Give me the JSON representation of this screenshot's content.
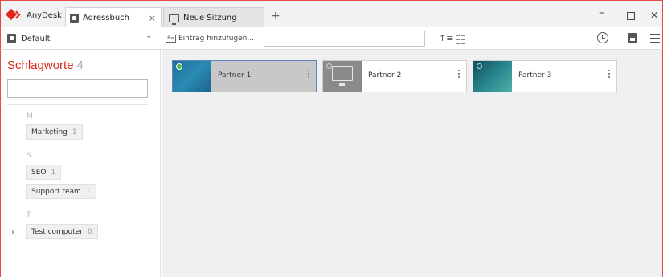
{
  "app": {
    "name": "AnyDesk"
  },
  "tabs": [
    {
      "label": "Adressbuch",
      "close": "×"
    },
    {
      "label": "Neue Sitzung"
    }
  ],
  "new_tab": "+",
  "window_controls": {
    "minimize": "–",
    "close": "✕"
  },
  "toolbar": {
    "address_book": "Default",
    "chevron": "⌄",
    "add_entry": "Eintrag hinzufügen...",
    "add_entry_icon": "8=",
    "search_value": "",
    "sort_icon": "↑≡"
  },
  "sidebar": {
    "title": "Schlagworte",
    "count": "4",
    "groups": [
      {
        "letter": "M",
        "tags": [
          {
            "label": "Marketing",
            "count": "1"
          }
        ]
      },
      {
        "letter": "S",
        "tags": [
          {
            "label": "SEO",
            "count": "1"
          },
          {
            "label": "Support team",
            "count": "1"
          }
        ]
      },
      {
        "letter": "T",
        "tags": [
          {
            "label": "Test computer",
            "count": "0"
          }
        ]
      }
    ],
    "expand": "›"
  },
  "partners": [
    {
      "label": "Partner 1",
      "status": "online",
      "selected": true
    },
    {
      "label": "Partner 2",
      "status": "offline",
      "selected": false
    },
    {
      "label": "Partner 3",
      "status": "offline",
      "selected": false
    }
  ],
  "colors": {
    "accent": "#e2231a",
    "selection": "#5b86c4",
    "online": "#4cb84c"
  }
}
